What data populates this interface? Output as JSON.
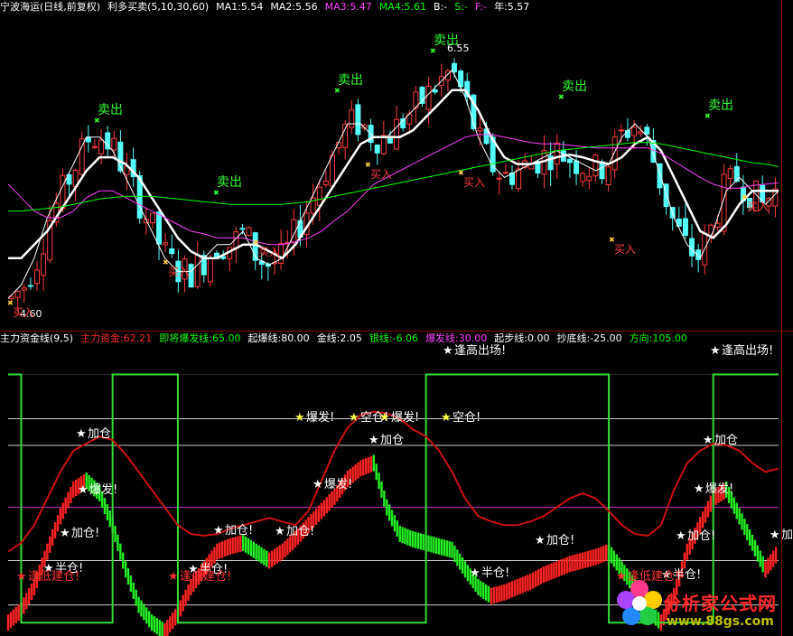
{
  "upper_header": {
    "title": "宁波海运(日线,前复权)",
    "indicator": "利多买卖(5,10,30,60)",
    "ma1": "MA1:5.54",
    "ma2": "MA2:5.56",
    "ma3": "MA3:5.47",
    "ma4": "MA4:5.61",
    "b": "B:-",
    "s": "S:-",
    "f": "F:-",
    "year": "年:5.57",
    "colors": {
      "title": "#ffffff",
      "ma1": "#ffffff",
      "ma2": "#ffffff",
      "ma3": "#ff40ff",
      "ma4": "#00ff00",
      "b": "#ffffff",
      "s": "#00ff00",
      "f": "#ff40ff",
      "year": "#ffffff"
    }
  },
  "lower_header": {
    "name": "主力资金线(9,5)",
    "main_fund": "主力资金:62.21",
    "imminent": "即将爆发线:65.00",
    "start": "起爆线:80.00",
    "gold": "金线:2.05",
    "silver": "银线:-6.06",
    "burst": "爆发线:30.00",
    "step": "起步线:0.00",
    "bottom": "抄底线:-25.00",
    "direction": "方向:105.00",
    "colors": {
      "name": "#ffffff",
      "main_fund": "#ff2a2a",
      "imminent": "#00ff00",
      "start": "#ffffff",
      "gold": "#ffffff",
      "silver": "#00ff00",
      "burst": "#ff40ff",
      "step": "#ffffff",
      "bottom": "#ffffff",
      "direction": "#00ff00"
    }
  },
  "price_labels": {
    "high": "6.55",
    "low": "4.60"
  },
  "upper_signals": [
    {
      "text": "卖出",
      "type": "sell"
    },
    {
      "text": "卖出",
      "type": "sell"
    },
    {
      "text": "卖出",
      "type": "sell"
    },
    {
      "text": "卖出",
      "type": "sell"
    },
    {
      "text": "卖出",
      "type": "sell"
    },
    {
      "text": "卖出",
      "type": "sell"
    },
    {
      "text": "买入",
      "type": "buy"
    },
    {
      "text": "买入",
      "type": "buy"
    },
    {
      "text": "买入",
      "type": "buy"
    },
    {
      "text": "买入",
      "type": "buy"
    },
    {
      "text": "买入",
      "type": "buy"
    },
    {
      "text": "买入",
      "type": "buy"
    },
    {
      "text": "买入",
      "type": "buy"
    }
  ],
  "lower_signals": [
    {
      "text": "加仓"
    },
    {
      "text": "爆发!"
    },
    {
      "text": "加仓!"
    },
    {
      "text": "半仓!"
    },
    {
      "text": "逢低建仓!"
    },
    {
      "text": "加仓!"
    },
    {
      "text": "加仓!"
    },
    {
      "text": "半仓!"
    },
    {
      "text": "逢低建仓!"
    },
    {
      "text": "爆发!"
    },
    {
      "text": "空仓!"
    },
    {
      "text": "爆发!"
    },
    {
      "text": "加仓"
    },
    {
      "text": "爆发!"
    },
    {
      "text": "空仓!"
    },
    {
      "text": "加仓!"
    },
    {
      "text": "半仓!"
    },
    {
      "text": "加仓"
    },
    {
      "text": "爆发!"
    },
    {
      "text": "加仓!"
    },
    {
      "text": "半仓!"
    },
    {
      "text": "逢低建仓!"
    },
    {
      "text": "加"
    },
    {
      "text": "逢高出场!"
    },
    {
      "text": "逢高出场!"
    }
  ],
  "watermark": {
    "title": "分析家公式网",
    "url": "www.88gs.com"
  },
  "chart_data": [
    {
      "type": "candlestick",
      "title": "宁波海运(日线,前复权)",
      "ylim": [
        4.5,
        6.8
      ],
      "high": 6.55,
      "low": 4.6,
      "series": [
        {
          "name": "MA1",
          "color": "#ffffff",
          "values": [
            4.7,
            4.8,
            5.0,
            5.3,
            5.5,
            5.7,
            5.9,
            5.9,
            5.8,
            5.6,
            5.4,
            5.2,
            5.0,
            4.9,
            4.9,
            5.0,
            5.1,
            5.1,
            5.2,
            5.0,
            4.95,
            5.0,
            5.2,
            5.4,
            5.6,
            5.8,
            6.0,
            6.0,
            5.9,
            5.9,
            6.0,
            6.1,
            6.2,
            6.3,
            6.4,
            6.2,
            5.9,
            5.7,
            5.6,
            5.65,
            5.7,
            5.75,
            5.8,
            5.75,
            5.7,
            5.65,
            5.7,
            5.9,
            6.0,
            5.9,
            5.6,
            5.3,
            5.1,
            5.0,
            5.2,
            5.5,
            5.6,
            5.5,
            5.4,
            5.5
          ]
        },
        {
          "name": "MA2",
          "color": "#ffffff",
          "values": [
            5.0,
            5.0,
            5.1,
            5.2,
            5.35,
            5.5,
            5.65,
            5.75,
            5.75,
            5.7,
            5.6,
            5.45,
            5.3,
            5.15,
            5.05,
            5.0,
            5.0,
            5.05,
            5.1,
            5.1,
            5.05,
            5.0,
            5.1,
            5.25,
            5.4,
            5.55,
            5.7,
            5.85,
            5.9,
            5.9,
            5.9,
            5.95,
            6.05,
            6.15,
            6.25,
            6.25,
            6.1,
            5.9,
            5.75,
            5.7,
            5.7,
            5.72,
            5.75,
            5.77,
            5.75,
            5.72,
            5.7,
            5.75,
            5.85,
            5.9,
            5.8,
            5.6,
            5.4,
            5.2,
            5.15,
            5.25,
            5.4,
            5.5,
            5.5,
            5.5
          ]
        },
        {
          "name": "MA3",
          "color": "#ff40ff",
          "values": [
            5.55,
            5.45,
            5.35,
            5.3,
            5.3,
            5.35,
            5.45,
            5.5,
            5.5,
            5.45,
            5.4,
            5.35,
            5.3,
            5.25,
            5.2,
            5.18,
            5.15,
            5.15,
            5.15,
            5.12,
            5.1,
            5.1,
            5.12,
            5.15,
            5.2,
            5.28,
            5.35,
            5.45,
            5.55,
            5.6,
            5.65,
            5.7,
            5.75,
            5.8,
            5.85,
            5.9,
            5.92,
            5.92,
            5.9,
            5.88,
            5.86,
            5.85,
            5.85,
            5.84,
            5.83,
            5.82,
            5.82,
            5.82,
            5.82,
            5.82,
            5.78,
            5.72,
            5.66,
            5.6,
            5.55,
            5.52,
            5.52,
            5.54,
            5.55,
            5.56
          ]
        },
        {
          "name": "MA4",
          "color": "#00ff00",
          "values": [
            5.35,
            5.35,
            5.36,
            5.37,
            5.38,
            5.4,
            5.42,
            5.44,
            5.45,
            5.46,
            5.46,
            5.46,
            5.45,
            5.44,
            5.43,
            5.42,
            5.41,
            5.4,
            5.4,
            5.4,
            5.4,
            5.4,
            5.41,
            5.42,
            5.44,
            5.46,
            5.48,
            5.5,
            5.52,
            5.54,
            5.56,
            5.58,
            5.6,
            5.62,
            5.64,
            5.66,
            5.68,
            5.7,
            5.72,
            5.74,
            5.76,
            5.78,
            5.8,
            5.81,
            5.82,
            5.83,
            5.84,
            5.85,
            5.86,
            5.86,
            5.85,
            5.83,
            5.81,
            5.79,
            5.77,
            5.75,
            5.73,
            5.71,
            5.7,
            5.68
          ]
        }
      ]
    },
    {
      "type": "line",
      "title": "主力资金线(9,5)",
      "ylim": [
        -40,
        120
      ],
      "levels": [
        {
          "name": "即将爆发线",
          "value": 65
        },
        {
          "name": "起爆线",
          "value": 80
        },
        {
          "name": "爆发线",
          "value": 30
        },
        {
          "name": "起步线",
          "value": 0
        },
        {
          "name": "抄底线",
          "value": -25
        },
        {
          "name": "方向",
          "value": 105
        }
      ],
      "series": [
        {
          "name": "主力资金",
          "color": "#cc1111",
          "values": [
            5,
            10,
            20,
            35,
            50,
            62,
            66,
            70,
            68,
            60,
            50,
            40,
            30,
            20,
            15,
            14,
            15,
            18,
            20,
            22,
            24,
            22,
            20,
            28,
            45,
            62,
            75,
            82,
            84,
            83,
            80,
            74,
            70,
            62,
            50,
            35,
            25,
            22,
            20,
            20,
            22,
            25,
            30,
            35,
            38,
            35,
            28,
            20,
            15,
            14,
            20,
            40,
            55,
            62,
            66,
            65,
            62,
            55,
            50,
            52
          ]
        },
        {
          "name": "金线",
          "color": "#e02020",
          "values": [
            -35,
            -28,
            -15,
            5,
            25,
            40,
            45,
            38,
            20,
            -5,
            -25,
            -35,
            -40,
            -30,
            -15,
            -5,
            5,
            8,
            10,
            5,
            0,
            5,
            12,
            20,
            28,
            36,
            46,
            52,
            55,
            30,
            15,
            12,
            10,
            8,
            6,
            -5,
            -15,
            -20,
            -18,
            -15,
            -12,
            -8,
            -5,
            -2,
            0,
            2,
            5,
            -5,
            -15,
            -28,
            -35,
            -20,
            5,
            20,
            35,
            40,
            25,
            10,
            -5,
            5
          ]
        },
        {
          "name": "方向",
          "color": "#33cc33",
          "values": [
            105,
            -35,
            -35,
            -35,
            -35,
            -35,
            -35,
            -35,
            105,
            105,
            105,
            105,
            105,
            -35,
            -35,
            -35,
            -35,
            -35,
            -35,
            -35,
            -35,
            -35,
            -35,
            -35,
            -35,
            -35,
            -35,
            -35,
            -35,
            -35,
            -35,
            -35,
            105,
            105,
            105,
            105,
            105,
            105,
            105,
            105,
            105,
            105,
            105,
            105,
            105,
            105,
            -35,
            -35,
            -35,
            -35,
            -35,
            -35,
            -35,
            -35,
            105,
            105,
            105,
            105,
            105,
            105
          ]
        }
      ]
    }
  ]
}
